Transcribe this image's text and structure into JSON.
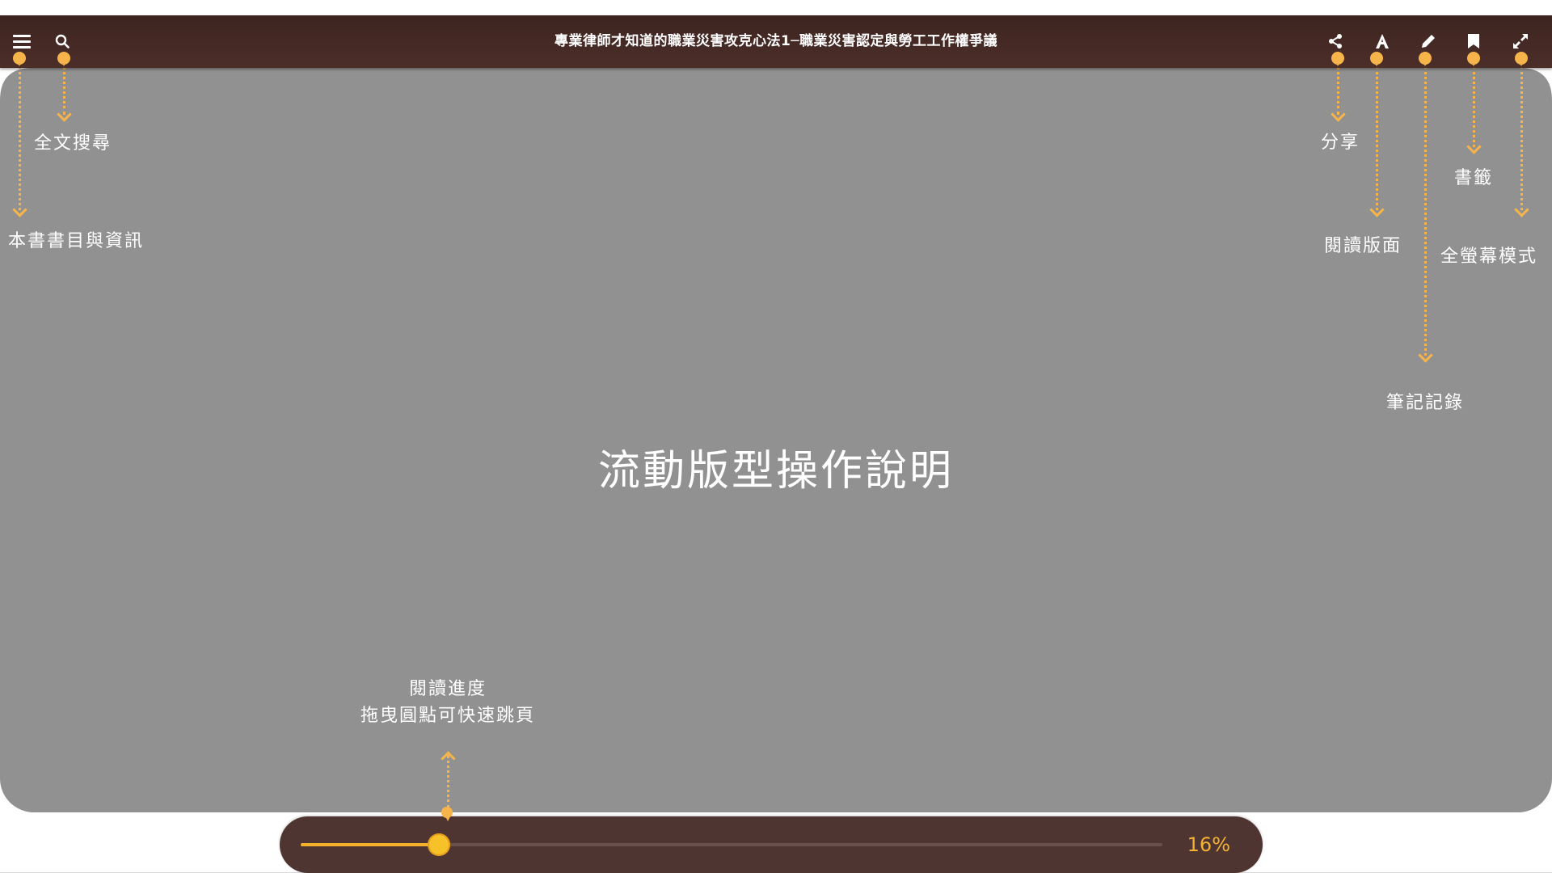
{
  "toolbar": {
    "book_title": "專業律師才知道的職業災害攻克心法1─職業災害認定與勞工工作權爭議"
  },
  "icons": {
    "menu": "hamburger-menu-icon",
    "search": "search-icon",
    "share": "share-icon",
    "font": "font-size-icon",
    "note": "pencil-icon",
    "bookmark": "bookmark-icon",
    "fullscreen": "expand-icon"
  },
  "guide": {
    "title": "流動版型操作說明",
    "labels": {
      "menu": "本書書目與資訊",
      "search": "全文搜尋",
      "share": "分享",
      "layout": "閱讀版面",
      "notes": "筆記記錄",
      "bookmark": "書籤",
      "fullscreen": "全螢幕模式",
      "progress_line1": "閱讀進度",
      "progress_line2": "拖曳圓點可快速跳頁"
    }
  },
  "progress": {
    "percent_value": 16,
    "percent_label": "16%"
  },
  "colors": {
    "toolbar": "#472b26",
    "overlay": "#919191",
    "accent": "#f6b44a",
    "progress_bar": "#4f3531"
  }
}
